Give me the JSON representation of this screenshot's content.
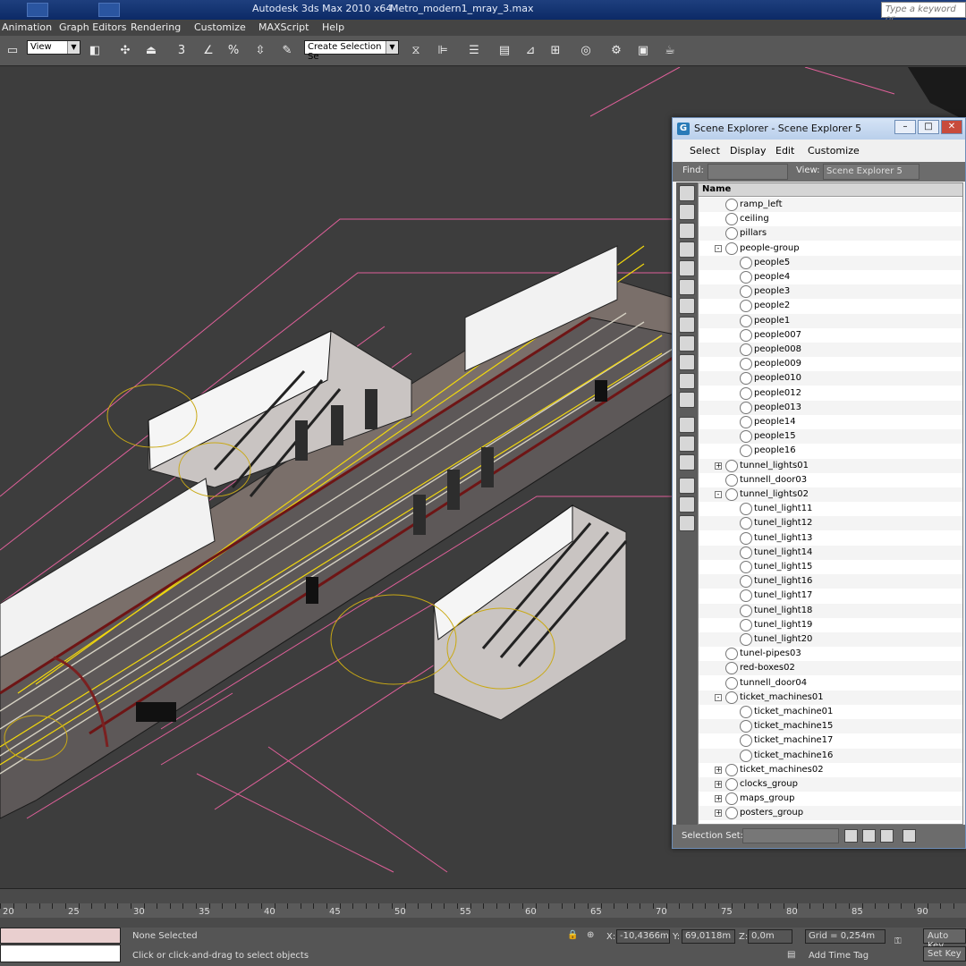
{
  "titlebar": {
    "app_title": "Autodesk 3ds Max  2010 x64",
    "file_title": "Metro_modern1_mray_3.max",
    "search_placeholder": "Type a keyword or"
  },
  "menubar": {
    "items": [
      "Animation",
      "Graph Editors",
      "Rendering",
      "Customize",
      "MAXScript",
      "Help"
    ]
  },
  "toolbar": {
    "view_select": "View",
    "selection_set": "Create Selection Se",
    "snap_label": "3",
    "percent_label": "%"
  },
  "scene_explorer": {
    "title": "Scene Explorer - Scene Explorer 5",
    "menu": [
      "Select",
      "Display",
      "Edit",
      "Customize"
    ],
    "find_label": "Find:",
    "view_label": "View:",
    "view_value": "Scene Explorer 5",
    "column_name": "Name",
    "rows": [
      {
        "label": "ramp_left",
        "level": 0,
        "expand": ""
      },
      {
        "label": "ceiling",
        "level": 0,
        "expand": ""
      },
      {
        "label": "pillars",
        "level": 0,
        "expand": ""
      },
      {
        "label": "people-group",
        "level": 0,
        "expand": "-"
      },
      {
        "label": "people5",
        "level": 1,
        "expand": ""
      },
      {
        "label": "people4",
        "level": 1,
        "expand": ""
      },
      {
        "label": "people3",
        "level": 1,
        "expand": ""
      },
      {
        "label": "people2",
        "level": 1,
        "expand": ""
      },
      {
        "label": "people1",
        "level": 1,
        "expand": ""
      },
      {
        "label": "people007",
        "level": 1,
        "expand": ""
      },
      {
        "label": "people008",
        "level": 1,
        "expand": ""
      },
      {
        "label": "people009",
        "level": 1,
        "expand": ""
      },
      {
        "label": "people010",
        "level": 1,
        "expand": ""
      },
      {
        "label": "people012",
        "level": 1,
        "expand": ""
      },
      {
        "label": "people013",
        "level": 1,
        "expand": ""
      },
      {
        "label": "people14",
        "level": 1,
        "expand": ""
      },
      {
        "label": "people15",
        "level": 1,
        "expand": ""
      },
      {
        "label": "people16",
        "level": 1,
        "expand": ""
      },
      {
        "label": "tunnel_lights01",
        "level": 0,
        "expand": "+"
      },
      {
        "label": "tunnell_door03",
        "level": 0,
        "expand": ""
      },
      {
        "label": "tunnel_lights02",
        "level": 0,
        "expand": "-"
      },
      {
        "label": "tunel_light11",
        "level": 1,
        "expand": ""
      },
      {
        "label": "tunel_light12",
        "level": 1,
        "expand": ""
      },
      {
        "label": "tunel_light13",
        "level": 1,
        "expand": ""
      },
      {
        "label": "tunel_light14",
        "level": 1,
        "expand": ""
      },
      {
        "label": "tunel_light15",
        "level": 1,
        "expand": ""
      },
      {
        "label": "tunel_light16",
        "level": 1,
        "expand": ""
      },
      {
        "label": "tunel_light17",
        "level": 1,
        "expand": ""
      },
      {
        "label": "tunel_light18",
        "level": 1,
        "expand": ""
      },
      {
        "label": "tunel_light19",
        "level": 1,
        "expand": ""
      },
      {
        "label": "tunel_light20",
        "level": 1,
        "expand": ""
      },
      {
        "label": "tunel-pipes03",
        "level": 0,
        "expand": ""
      },
      {
        "label": "red-boxes02",
        "level": 0,
        "expand": ""
      },
      {
        "label": "tunnell_door04",
        "level": 0,
        "expand": ""
      },
      {
        "label": "ticket_machines01",
        "level": 0,
        "expand": "-"
      },
      {
        "label": "ticket_machine01",
        "level": 1,
        "expand": ""
      },
      {
        "label": "ticket_machine15",
        "level": 1,
        "expand": ""
      },
      {
        "label": "ticket_machine17",
        "level": 1,
        "expand": ""
      },
      {
        "label": "ticket_machine16",
        "level": 1,
        "expand": ""
      },
      {
        "label": "ticket_machines02",
        "level": 0,
        "expand": "+"
      },
      {
        "label": "clocks_group",
        "level": 0,
        "expand": "+"
      },
      {
        "label": "maps_group",
        "level": 0,
        "expand": "+"
      },
      {
        "label": "posters_group",
        "level": 0,
        "expand": "+"
      }
    ],
    "selection_set_label": "Selection Set:"
  },
  "timeline": {
    "ticks": [
      "20",
      "25",
      "30",
      "35",
      "40",
      "45",
      "50",
      "55",
      "60",
      "65",
      "70",
      "75",
      "80",
      "85",
      "90"
    ]
  },
  "status": {
    "none_selected": "None Selected",
    "prompt": "Click or click-and-drag to select objects",
    "x_label": "X:",
    "x_value": "-10,4366m",
    "y_label": "Y:",
    "y_value": "69,0118m",
    "z_label": "Z:",
    "z_value": "0,0m",
    "grid": "Grid = 0,254m",
    "add_time_tag": "Add Time Tag",
    "auto_key": "Auto Key",
    "set_key": "Set Key"
  }
}
